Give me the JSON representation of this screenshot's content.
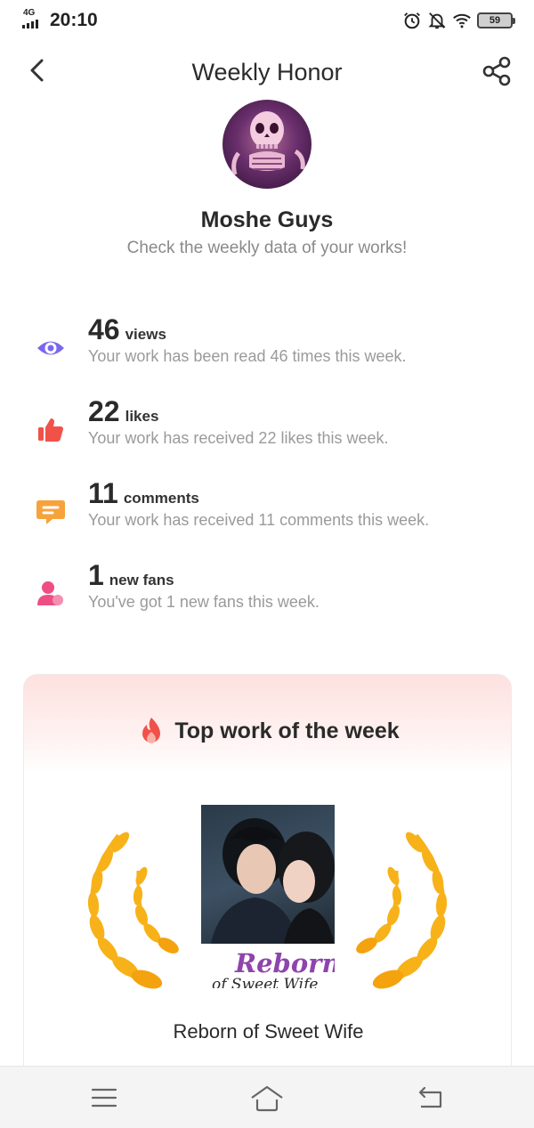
{
  "status": {
    "network": "4G",
    "time": "20:10",
    "battery": "59"
  },
  "header": {
    "title": "Weekly Honor"
  },
  "profile": {
    "name": "Moshe Guys",
    "subtitle": "Check the weekly data of your works!"
  },
  "stats": [
    {
      "icon": "eye-icon",
      "color": "#7b68ee",
      "value": "46",
      "unit": "views",
      "description": "Your work has been read 46 times this week."
    },
    {
      "icon": "thumbs-up-icon",
      "color": "#f0524a",
      "value": "22",
      "unit": "likes",
      "description": "Your work has received 22 likes this week."
    },
    {
      "icon": "comment-icon",
      "color": "#f7a23b",
      "value": "11",
      "unit": "comments",
      "description": "Your work has received 11 comments this week."
    },
    {
      "icon": "person-icon",
      "color": "#ef4e83",
      "value": "1",
      "unit": "new fans",
      "description": "You've got 1 new fans this week."
    }
  ],
  "top_work": {
    "heading": "Top work of the week",
    "cover_title": "Reborn",
    "cover_subtitle": "of Sweet Wife",
    "name": "Reborn of Sweet Wife"
  },
  "colors": {
    "accent": "#f0524a",
    "laurel": "#f7b21a",
    "card_gradient_top": "#fde1df"
  },
  "navigation": [
    "menu-icon",
    "home-icon",
    "back-return-icon"
  ]
}
